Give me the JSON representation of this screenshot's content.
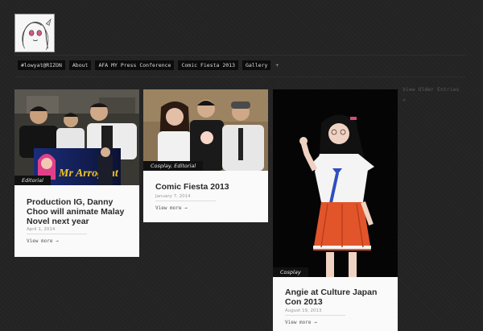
{
  "nav": {
    "items": [
      "#lowyat@RIZON",
      "About",
      "AFA MY Press Conference",
      "Comic Fiesta 2013",
      "Gallery"
    ],
    "more": "+"
  },
  "posts": [
    {
      "category": "Editorial",
      "title": "Production IG, Danny Choo will animate Malay Novel next year",
      "date": "April 1, 2014",
      "more": "View more →",
      "photo_caption": "Mr Arrogant"
    },
    {
      "category": "Cosplay, Editorial",
      "title": "Comic Fiesta 2013",
      "date": "January 7, 2014",
      "more": "View more →"
    },
    {
      "category": "Cosplay",
      "title": "Angie at Culture Japan Con 2013",
      "date": "August 19, 2013",
      "more": "View more →"
    }
  ],
  "pagination": {
    "older": "View Older Entries",
    "bullet": "»"
  }
}
